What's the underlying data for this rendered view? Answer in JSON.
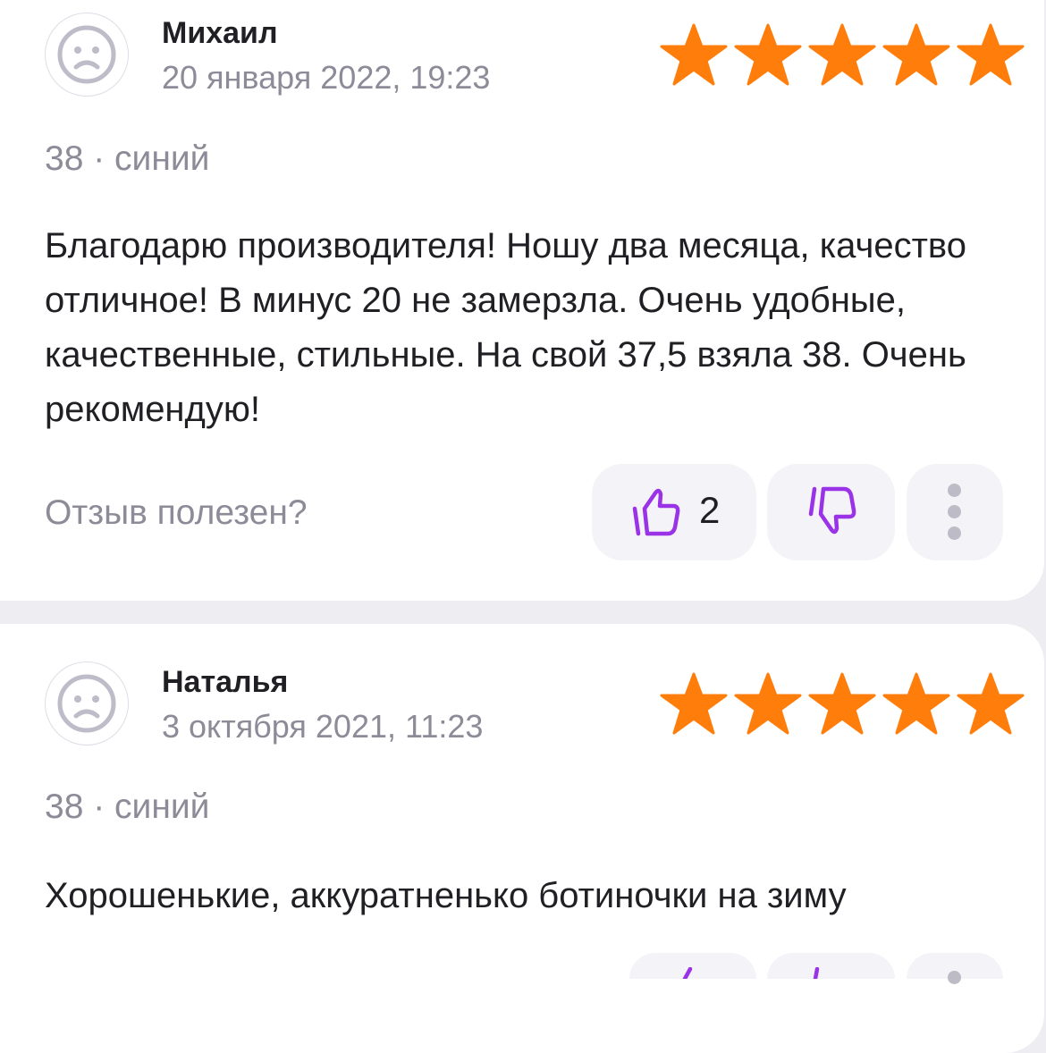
{
  "reviews": [
    {
      "author": "Михаил",
      "date": "20 января 2022, 19:23",
      "rating": 5,
      "variant": "38 · синий",
      "text": "Благодарю производителя! Ношу два месяца, качество отличное! В минус 20 не замерзла. Очень удобные, качественные, стильные. На свой 37,5 взяла 38. Очень рекомендую!",
      "helpful_prompt": "Отзыв полезен?",
      "likes": "2"
    },
    {
      "author": "Наталья",
      "date": "3 октября 2021, 11:23",
      "rating": 5,
      "variant": "38 · синий",
      "text": "Хорошенькие, аккуратненько ботиночки на зиму"
    }
  ],
  "icons": {
    "avatar": "sad-face-icon",
    "star": "star-icon",
    "like": "thumbs-up-icon",
    "dislike": "thumbs-down-icon",
    "more": "more-vertical-icon"
  },
  "colors": {
    "star": "#ff7d0b",
    "accent": "#9a32e8",
    "muted": "#8d8b98",
    "text": "#1f1f24",
    "background": "#eeeef2",
    "pill": "#f4f3f7"
  }
}
